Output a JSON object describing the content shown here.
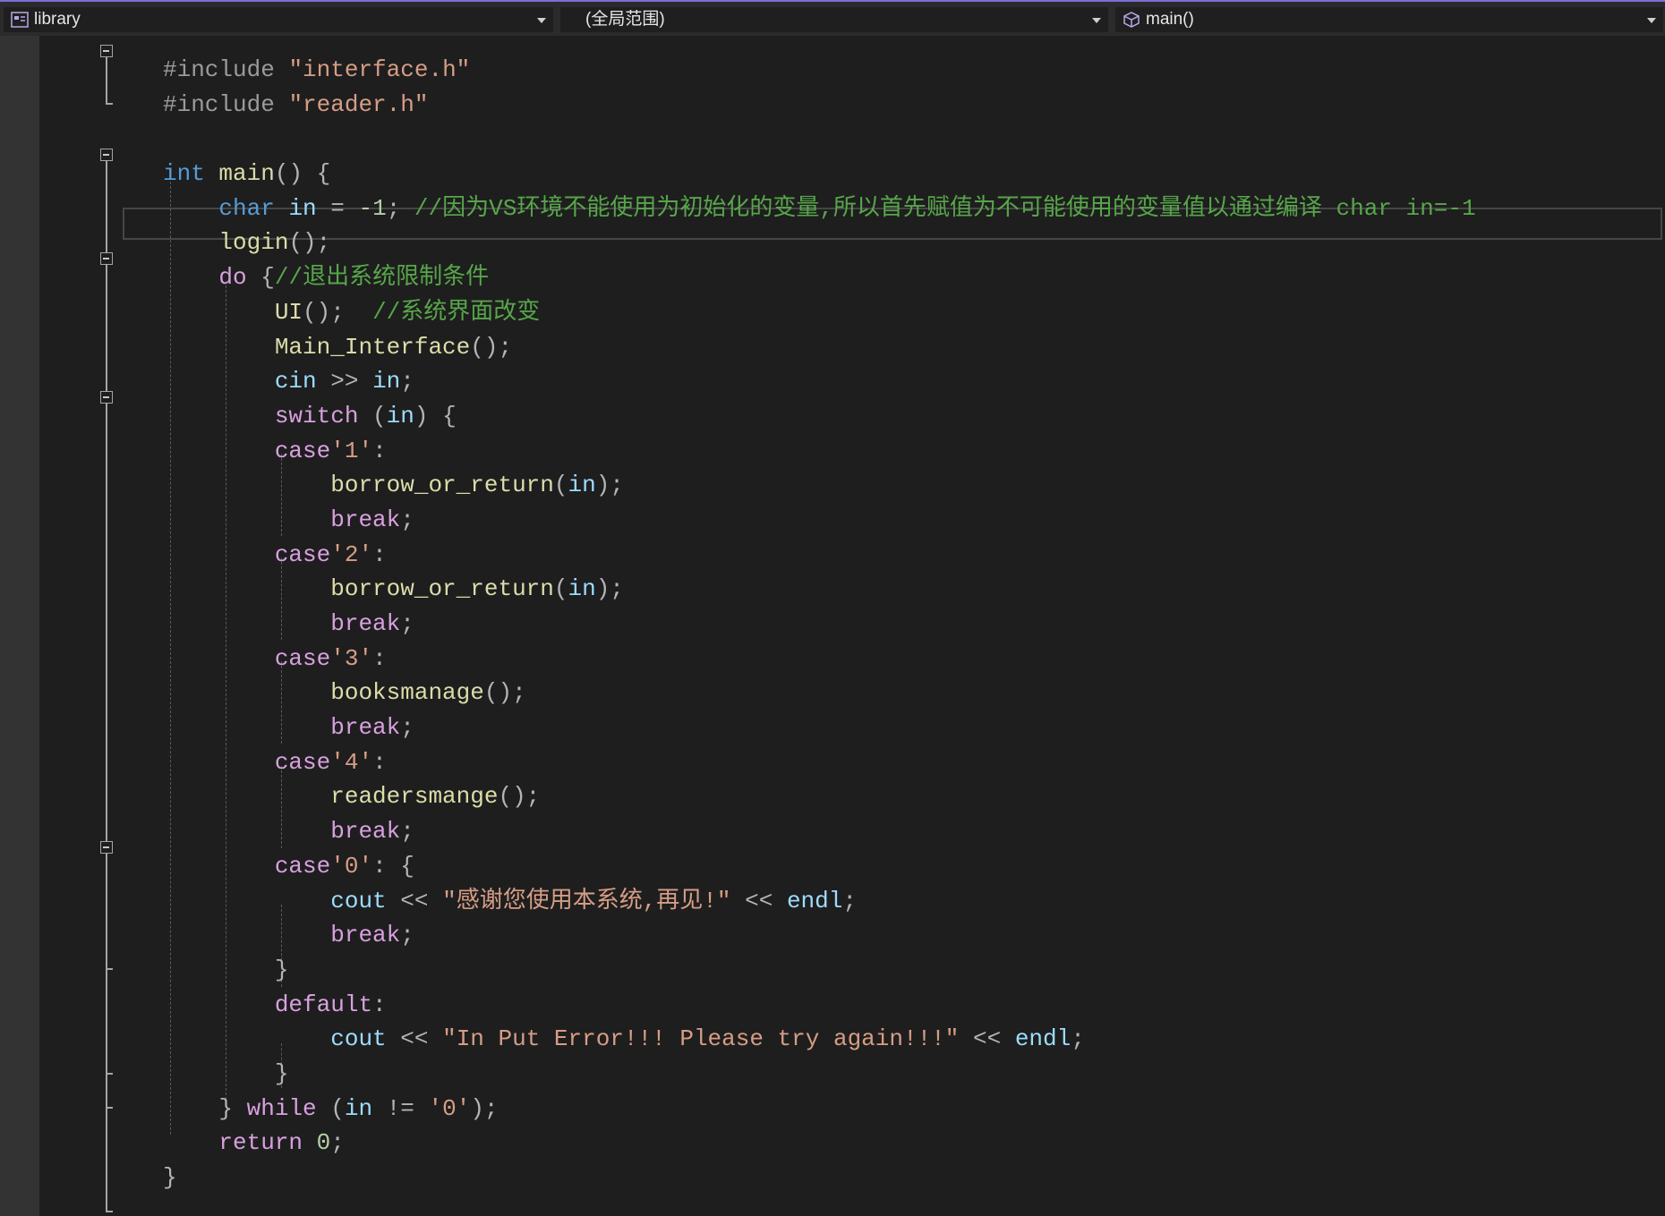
{
  "navbar": {
    "project": "library",
    "scope": "(全局范围)",
    "function": "main()"
  },
  "code": {
    "lines": [
      [
        [
          "pp",
          "#include "
        ],
        [
          "str",
          "\"interface.h\""
        ]
      ],
      [
        [
          "pp",
          "#include "
        ],
        [
          "str",
          "\"reader.h\""
        ]
      ],
      [],
      [
        [
          "kw",
          "int"
        ],
        [
          "df",
          " "
        ],
        [
          "fn",
          "main"
        ],
        [
          "pn",
          "() {"
        ]
      ],
      [
        [
          "df",
          "    "
        ],
        [
          "kw",
          "char"
        ],
        [
          "df",
          " "
        ],
        [
          "var",
          "in"
        ],
        [
          "pn",
          " = "
        ],
        [
          "num",
          "-1"
        ],
        [
          "pn",
          "; "
        ],
        [
          "cmt",
          "//因为VS环境不能使用为初始化的变量,所以首先赋值为不可能使用的变量值以通过编译 char in=-1"
        ]
      ],
      [
        [
          "df",
          "    "
        ],
        [
          "fn",
          "login"
        ],
        [
          "pn",
          "();"
        ]
      ],
      [
        [
          "df",
          "    "
        ],
        [
          "ctl",
          "do"
        ],
        [
          "pn",
          " {"
        ],
        [
          "cmt",
          "//退出系统限制条件"
        ]
      ],
      [
        [
          "df",
          "        "
        ],
        [
          "fn",
          "UI"
        ],
        [
          "pn",
          "();  "
        ],
        [
          "cmt",
          "//系统界面改变"
        ]
      ],
      [
        [
          "df",
          "        "
        ],
        [
          "fn",
          "Main_Interface"
        ],
        [
          "pn",
          "();"
        ]
      ],
      [
        [
          "df",
          "        "
        ],
        [
          "var",
          "cin"
        ],
        [
          "df",
          " "
        ],
        [
          "pn",
          ">>"
        ],
        [
          "df",
          " "
        ],
        [
          "var",
          "in"
        ],
        [
          "pn",
          ";"
        ]
      ],
      [
        [
          "df",
          "        "
        ],
        [
          "ctl",
          "switch"
        ],
        [
          "pn",
          " ("
        ],
        [
          "var",
          "in"
        ],
        [
          "pn",
          ") {"
        ]
      ],
      [
        [
          "df",
          "        "
        ],
        [
          "ctl",
          "case"
        ],
        [
          "str",
          "'1'"
        ],
        [
          "pn",
          ":"
        ]
      ],
      [
        [
          "df",
          "            "
        ],
        [
          "fn",
          "borrow_or_return"
        ],
        [
          "pn",
          "("
        ],
        [
          "var",
          "in"
        ],
        [
          "pn",
          ");"
        ]
      ],
      [
        [
          "df",
          "            "
        ],
        [
          "ctl",
          "break"
        ],
        [
          "pn",
          ";"
        ]
      ],
      [
        [
          "df",
          "        "
        ],
        [
          "ctl",
          "case"
        ],
        [
          "str",
          "'2'"
        ],
        [
          "pn",
          ":"
        ]
      ],
      [
        [
          "df",
          "            "
        ],
        [
          "fn",
          "borrow_or_return"
        ],
        [
          "pn",
          "("
        ],
        [
          "var",
          "in"
        ],
        [
          "pn",
          ");"
        ]
      ],
      [
        [
          "df",
          "            "
        ],
        [
          "ctl",
          "break"
        ],
        [
          "pn",
          ";"
        ]
      ],
      [
        [
          "df",
          "        "
        ],
        [
          "ctl",
          "case"
        ],
        [
          "str",
          "'3'"
        ],
        [
          "pn",
          ":"
        ]
      ],
      [
        [
          "df",
          "            "
        ],
        [
          "fn",
          "booksmanage"
        ],
        [
          "pn",
          "();"
        ]
      ],
      [
        [
          "df",
          "            "
        ],
        [
          "ctl",
          "break"
        ],
        [
          "pn",
          ";"
        ]
      ],
      [
        [
          "df",
          "        "
        ],
        [
          "ctl",
          "case"
        ],
        [
          "str",
          "'4'"
        ],
        [
          "pn",
          ":"
        ]
      ],
      [
        [
          "df",
          "            "
        ],
        [
          "fn",
          "readersmange"
        ],
        [
          "pn",
          "();"
        ]
      ],
      [
        [
          "df",
          "            "
        ],
        [
          "ctl",
          "break"
        ],
        [
          "pn",
          ";"
        ]
      ],
      [
        [
          "df",
          "        "
        ],
        [
          "ctl",
          "case"
        ],
        [
          "str",
          "'0'"
        ],
        [
          "pn",
          ": {"
        ]
      ],
      [
        [
          "df",
          "            "
        ],
        [
          "var",
          "cout"
        ],
        [
          "df",
          " "
        ],
        [
          "pn",
          "<<"
        ],
        [
          "df",
          " "
        ],
        [
          "str",
          "\"感谢您使用本系统,再见!\""
        ],
        [
          "df",
          " "
        ],
        [
          "pn",
          "<<"
        ],
        [
          "df",
          " "
        ],
        [
          "var",
          "endl"
        ],
        [
          "pn",
          ";"
        ]
      ],
      [
        [
          "df",
          "            "
        ],
        [
          "ctl",
          "break"
        ],
        [
          "pn",
          ";"
        ]
      ],
      [
        [
          "df",
          "        "
        ],
        [
          "pn",
          "}"
        ]
      ],
      [
        [
          "df",
          "        "
        ],
        [
          "ctl",
          "default"
        ],
        [
          "pn",
          ":"
        ]
      ],
      [
        [
          "df",
          "            "
        ],
        [
          "var",
          "cout"
        ],
        [
          "df",
          " "
        ],
        [
          "pn",
          "<<"
        ],
        [
          "df",
          " "
        ],
        [
          "str",
          "\"In Put Error!!! Please try again!!!\""
        ],
        [
          "df",
          " "
        ],
        [
          "pn",
          "<<"
        ],
        [
          "df",
          " "
        ],
        [
          "var",
          "endl"
        ],
        [
          "pn",
          ";"
        ]
      ],
      [
        [
          "df",
          "        "
        ],
        [
          "pn",
          "}"
        ]
      ],
      [
        [
          "df",
          "    "
        ],
        [
          "pn",
          "} "
        ],
        [
          "ctl",
          "while"
        ],
        [
          "pn",
          " ("
        ],
        [
          "var",
          "in"
        ],
        [
          "pn",
          " != "
        ],
        [
          "str",
          "'0'"
        ],
        [
          "pn",
          ");"
        ]
      ],
      [
        [
          "df",
          "    "
        ],
        [
          "ctl",
          "return"
        ],
        [
          "df",
          " "
        ],
        [
          "num",
          "0"
        ],
        [
          "pn",
          ";"
        ]
      ],
      [
        [
          "pn",
          "}"
        ]
      ]
    ]
  }
}
